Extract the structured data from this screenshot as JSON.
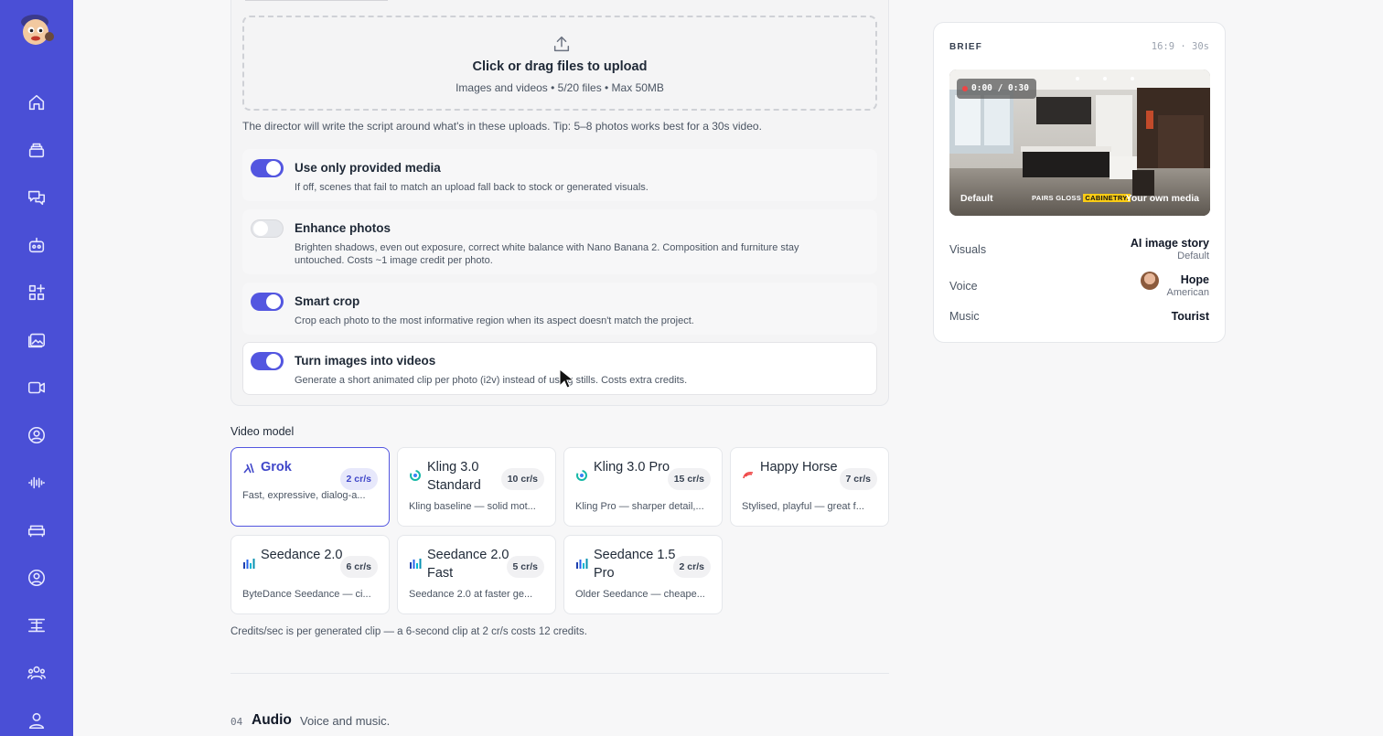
{
  "sidebar": {
    "items": [
      {
        "icon": "home-icon"
      },
      {
        "icon": "layers-icon"
      },
      {
        "icon": "chat-icon"
      },
      {
        "icon": "robot-icon"
      },
      {
        "icon": "apps-icon"
      },
      {
        "icon": "gallery-icon"
      },
      {
        "icon": "video-icon"
      },
      {
        "icon": "user-circle-icon"
      },
      {
        "icon": "audio-wave-icon"
      },
      {
        "icon": "sofa-icon"
      },
      {
        "icon": "account-icon"
      },
      {
        "icon": "workflow-icon"
      },
      {
        "icon": "team-icon"
      },
      {
        "icon": "profile-icon"
      }
    ]
  },
  "upload": {
    "title": "Click or drag files to upload",
    "subtitle": "Images and videos • 5/20 files • Max 50MB",
    "tip": "The director will write the script around what's in these uploads. Tip: 5–8 photos works best for a 30s video."
  },
  "options": [
    {
      "title": "Use only provided media",
      "desc": "If off, scenes that fail to match an upload fall back to stock or generated visuals.",
      "enabled": true
    },
    {
      "title": "Enhance photos",
      "desc": "Brighten shadows, even out exposure, correct white balance with Nano Banana 2. Composition and furniture stay untouched. Costs ~1 image credit per photo.",
      "enabled": false
    },
    {
      "title": "Smart crop",
      "desc": "Crop each photo to the most informative region when its aspect doesn't match the project.",
      "enabled": true
    },
    {
      "title": "Turn images into videos",
      "desc": "Generate a short animated clip per photo (i2v) instead of using stills. Costs extra credits.",
      "enabled": true
    }
  ],
  "video_model": {
    "label": "Video model",
    "models": [
      {
        "name": "Grok",
        "rate": "2 cr/s",
        "desc": "Fast, expressive, dialog-a...",
        "selected": true
      },
      {
        "name": "Kling 3.0 Standard",
        "rate": "10 cr/s",
        "desc": "Kling baseline — solid mot..."
      },
      {
        "name": "Kling 3.0 Pro",
        "rate": "15 cr/s",
        "desc": "Kling Pro — sharper detail,..."
      },
      {
        "name": "Happy Horse",
        "rate": "7 cr/s",
        "desc": "Stylised, playful — great f..."
      },
      {
        "name": "Seedance 2.0",
        "rate": "6 cr/s",
        "desc": "ByteDance Seedance — ci..."
      },
      {
        "name": "Seedance 2.0 Fast",
        "rate": "5 cr/s",
        "desc": "Seedance 2.0 at faster ge..."
      },
      {
        "name": "Seedance 1.5 Pro",
        "rate": "2 cr/s",
        "desc": "Older Seedance — cheape..."
      }
    ],
    "note": "Credits/sec is per generated clip — a 6-second clip at 2 cr/s costs 12 credits."
  },
  "next_section": {
    "number": "04",
    "title": "Audio",
    "subtitle": "Voice and music."
  },
  "brief": {
    "label": "BRIEF",
    "meta": "16:9 · 30s",
    "preview": {
      "time": "0:00 / 0:30",
      "caption_left": "Default",
      "caption_mid_a": "PAIRS GLOSS",
      "caption_mid_b": "CABINETRY.",
      "caption_right": "Your own media"
    },
    "rows": {
      "visuals": {
        "key": "Visuals",
        "value": "AI image story",
        "sub": "Default"
      },
      "voice": {
        "key": "Voice",
        "value": "Hope",
        "sub": "American"
      },
      "music": {
        "key": "Music",
        "value": "Tourist"
      }
    }
  },
  "colors": {
    "accent": "#5356e0",
    "sidebar": "#4a4fd6"
  }
}
